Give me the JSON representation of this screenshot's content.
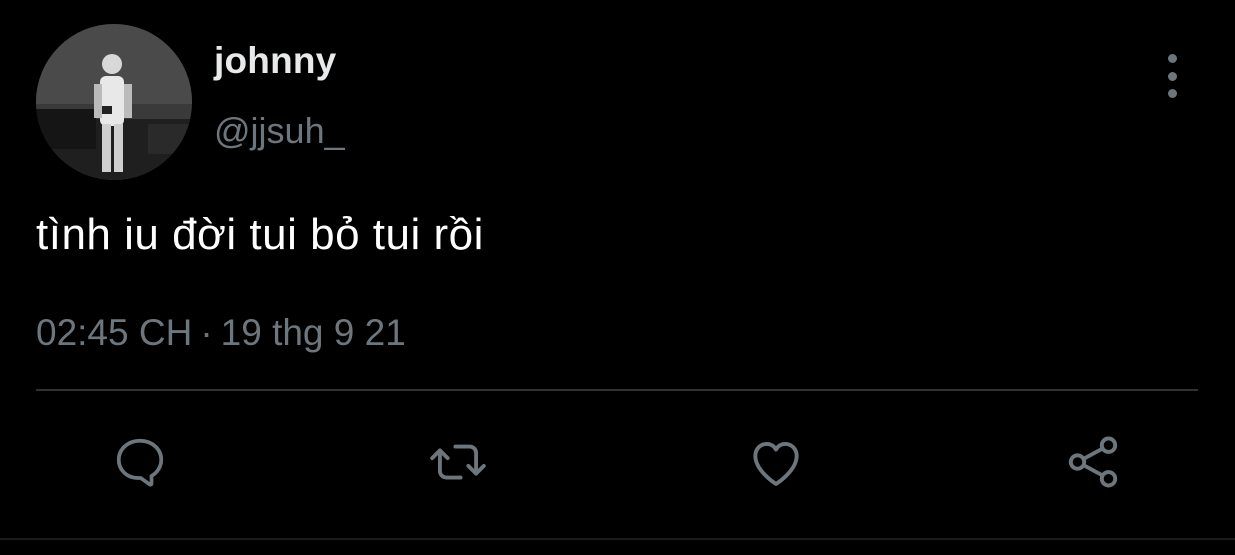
{
  "tweet": {
    "display_name": "johnny",
    "handle": "@jjsuh_",
    "text": "tình iu đời tui bỏ tui rồi",
    "time": "02:45 CH",
    "separator": "·",
    "date": "19 thg 9 21"
  },
  "icons": {
    "more": "more-vertical-icon",
    "reply": "reply-icon",
    "retweet": "retweet-icon",
    "like": "heart-icon",
    "share": "share-icon"
  },
  "colors": {
    "background": "#000000",
    "primary_text": "#e7e9ea",
    "secondary_text": "#6e767d",
    "divider": "#2f3336",
    "icon": "#6e767d"
  }
}
